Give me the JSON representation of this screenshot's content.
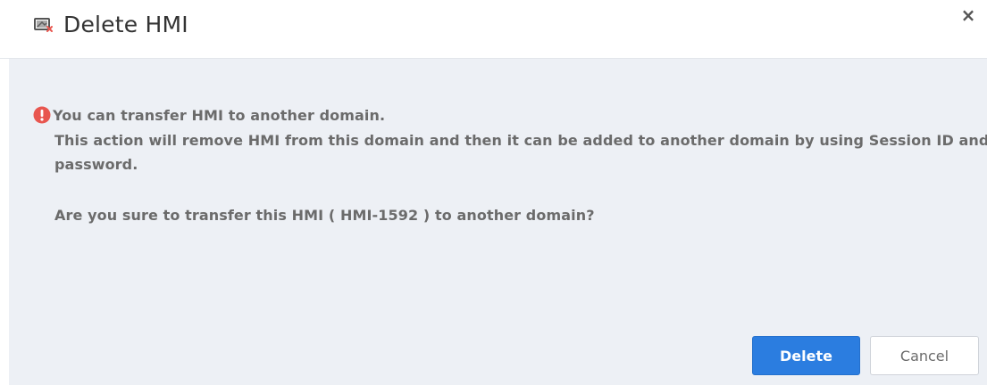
{
  "dialog": {
    "title": "Delete HMI",
    "title_icon": "hmi-delete-icon",
    "close_icon": "close-icon",
    "close_label": "×"
  },
  "message": {
    "warning_icon": "warning-circle-icon",
    "line1": "You can transfer HMI to another domain.",
    "line2": "This action will remove HMI from this domain and then it can be added to another domain by using Session ID and",
    "line3": "password.",
    "line4": "Are you sure to transfer this HMI ( HMI-1592 ) to another domain?"
  },
  "buttons": {
    "delete_label": "Delete",
    "cancel_label": "Cancel"
  },
  "colors": {
    "primary": "#2b7de0",
    "body_bg": "#edf0f5",
    "warning": "#e8564f",
    "text": "#6b6b6b"
  }
}
